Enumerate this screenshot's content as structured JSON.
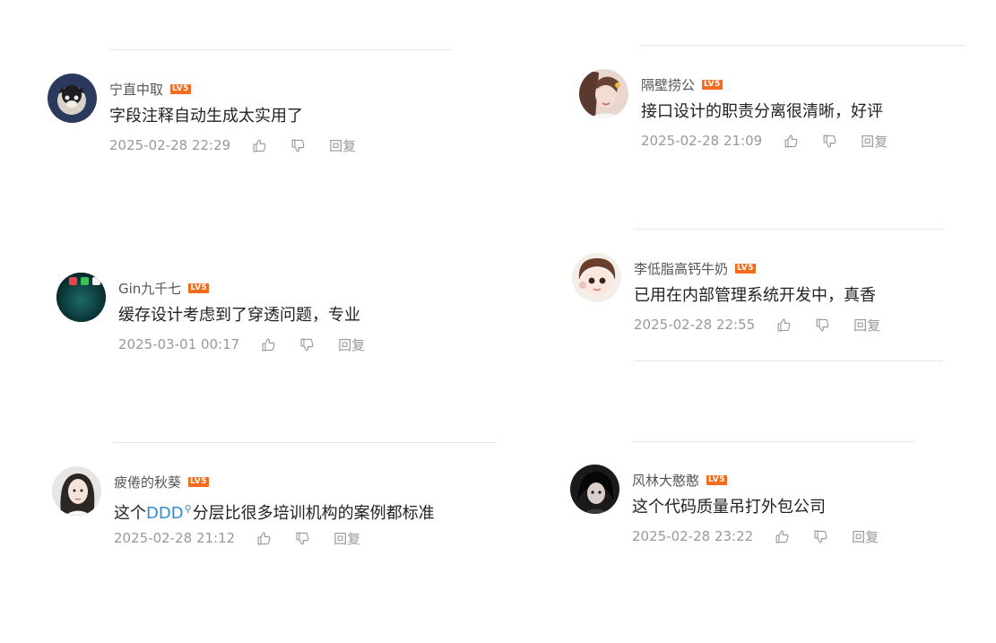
{
  "comments": [
    {
      "username": "宁直中取",
      "level": "LV5",
      "content": "字段注释自动生成太实用了",
      "time": "2025-02-28 22:29",
      "like_icon": "thumbs-up-icon",
      "dislike_icon": "thumbs-down-icon",
      "reply": "回复"
    },
    {
      "username": "隔壁捞公",
      "level": "LV5",
      "content": "接口设计的职责分离很清晰，好评",
      "time": "2025-02-28 21:09",
      "like_icon": "thumbs-up-icon",
      "dislike_icon": "thumbs-down-icon",
      "reply": "回复"
    },
    {
      "username": "Gin九千七",
      "level": "LV5",
      "content": "缓存设计考虑到了穿透问题，专业",
      "time": "2025-03-01 00:17",
      "like_icon": "thumbs-up-icon",
      "dislike_icon": "thumbs-down-icon",
      "reply": "回复"
    },
    {
      "username": "李低脂高钙牛奶",
      "level": "LV5",
      "content": "已用在内部管理系统开发中，真香",
      "time": "2025-02-28 22:55",
      "like_icon": "thumbs-up-icon",
      "dislike_icon": "thumbs-down-icon",
      "reply": "回复"
    },
    {
      "username": "疲倦的秋葵",
      "level": "LV5",
      "content_prefix": "这个",
      "content_link": "DDD",
      "content_link_icon": "search-icon",
      "content_suffix": "分层比很多培训机构的案例都标准",
      "time": "2025-02-28 21:12",
      "like_icon": "thumbs-up-icon",
      "dislike_icon": "thumbs-down-icon",
      "reply": "回复"
    },
    {
      "username": "风林大憨憨",
      "level": "LV5",
      "content": "这个代码质量吊打外包公司",
      "time": "2025-02-28 23:22",
      "like_icon": "thumbs-up-icon",
      "dislike_icon": "thumbs-down-icon",
      "reply": "回复"
    }
  ],
  "colors": {
    "badge": "#f36b1c",
    "link": "#2f8cd6",
    "meta_text": "#999999",
    "divider": "#e6e6e6"
  }
}
